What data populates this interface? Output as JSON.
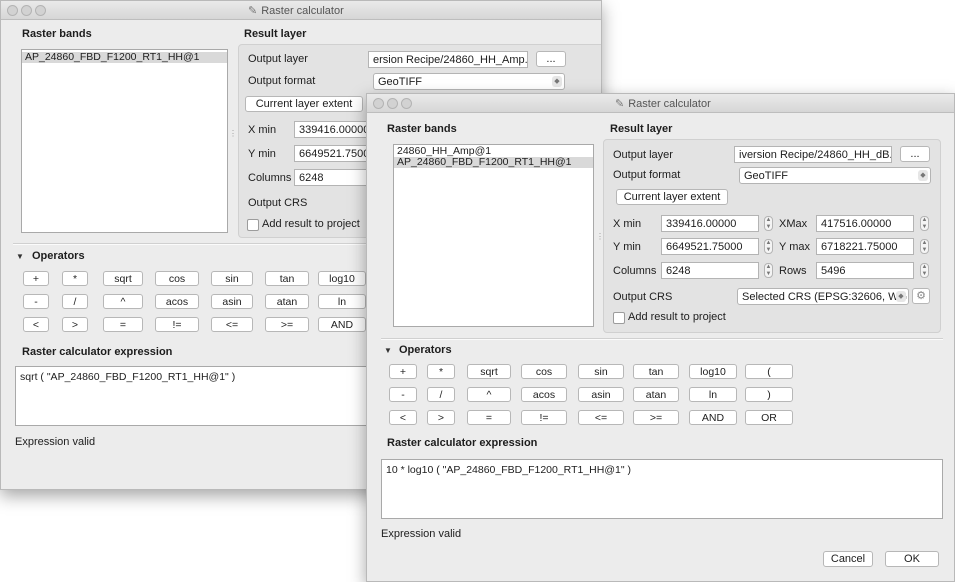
{
  "back": {
    "title": "Raster calculator",
    "raster_bands_label": "Raster bands",
    "bands": [
      "AP_24860_FBD_F1200_RT1_HH@1"
    ],
    "result_layer_label": "Result layer",
    "output_layer_label": "Output layer",
    "output_layer_value": "ersion Recipe/24860_HH_Amp.tif",
    "browse_label": "...",
    "output_format_label": "Output format",
    "output_format_value": "GeoTIFF",
    "current_extent_label": "Current layer extent",
    "xmin_label": "X min",
    "xmin_value": "339416.00000",
    "ymin_label": "Y min",
    "ymin_value": "6649521.75000",
    "columns_label": "Columns",
    "columns_value": "6248",
    "output_crs_label": "Output CRS",
    "add_result_label": "Add result to project",
    "operators_label": "Operators",
    "operators_row1": [
      "+",
      "*",
      "sqrt",
      "cos",
      "sin",
      "tan",
      "log10"
    ],
    "operators_row2": [
      "-",
      "/",
      "^",
      "acos",
      "asin",
      "atan",
      "ln"
    ],
    "operators_row3": [
      "<",
      ">",
      "=",
      "!=",
      "<=",
      ">=",
      "AND"
    ],
    "expression_label": "Raster calculator expression",
    "expression": "sqrt ( \"AP_24860_FBD_F1200_RT1_HH@1\" )",
    "status": "Expression valid"
  },
  "front": {
    "title": "Raster calculator",
    "raster_bands_label": "Raster bands",
    "bands": [
      "24860_HH_Amp@1",
      "AP_24860_FBD_F1200_RT1_HH@1"
    ],
    "result_layer_label": "Result layer",
    "output_layer_label": "Output layer",
    "output_layer_value": "iversion Recipe/24860_HH_dB.tif",
    "browse_label": "...",
    "output_format_label": "Output format",
    "output_format_value": "GeoTIFF",
    "current_extent_label": "Current layer extent",
    "xmin_label": "X min",
    "xmin_value": "339416.00000",
    "xmax_label": "XMax",
    "xmax_value": "417516.00000",
    "ymin_label": "Y min",
    "ymin_value": "6649521.75000",
    "ymax_label": "Y max",
    "ymax_value": "6718221.75000",
    "columns_label": "Columns",
    "columns_value": "6248",
    "rows_label": "Rows",
    "rows_value": "5496",
    "output_crs_label": "Output CRS",
    "crs_value": "Selected CRS (EPSG:32606, WG",
    "add_result_label": "Add result to project",
    "operators_label": "Operators",
    "operators_row1": [
      "+",
      "*",
      "sqrt",
      "cos",
      "sin",
      "tan",
      "log10",
      "("
    ],
    "operators_row2": [
      "-",
      "/",
      "^",
      "acos",
      "asin",
      "atan",
      "ln",
      ")"
    ],
    "operators_row3": [
      "<",
      ">",
      "=",
      "!=",
      "<=",
      ">=",
      "AND",
      "OR"
    ],
    "expression_label": "Raster calculator expression",
    "expression": "10 * log10 ( \"AP_24860_FBD_F1200_RT1_HH@1\" )",
    "status": "Expression valid",
    "cancel_label": "Cancel",
    "ok_label": "OK"
  }
}
